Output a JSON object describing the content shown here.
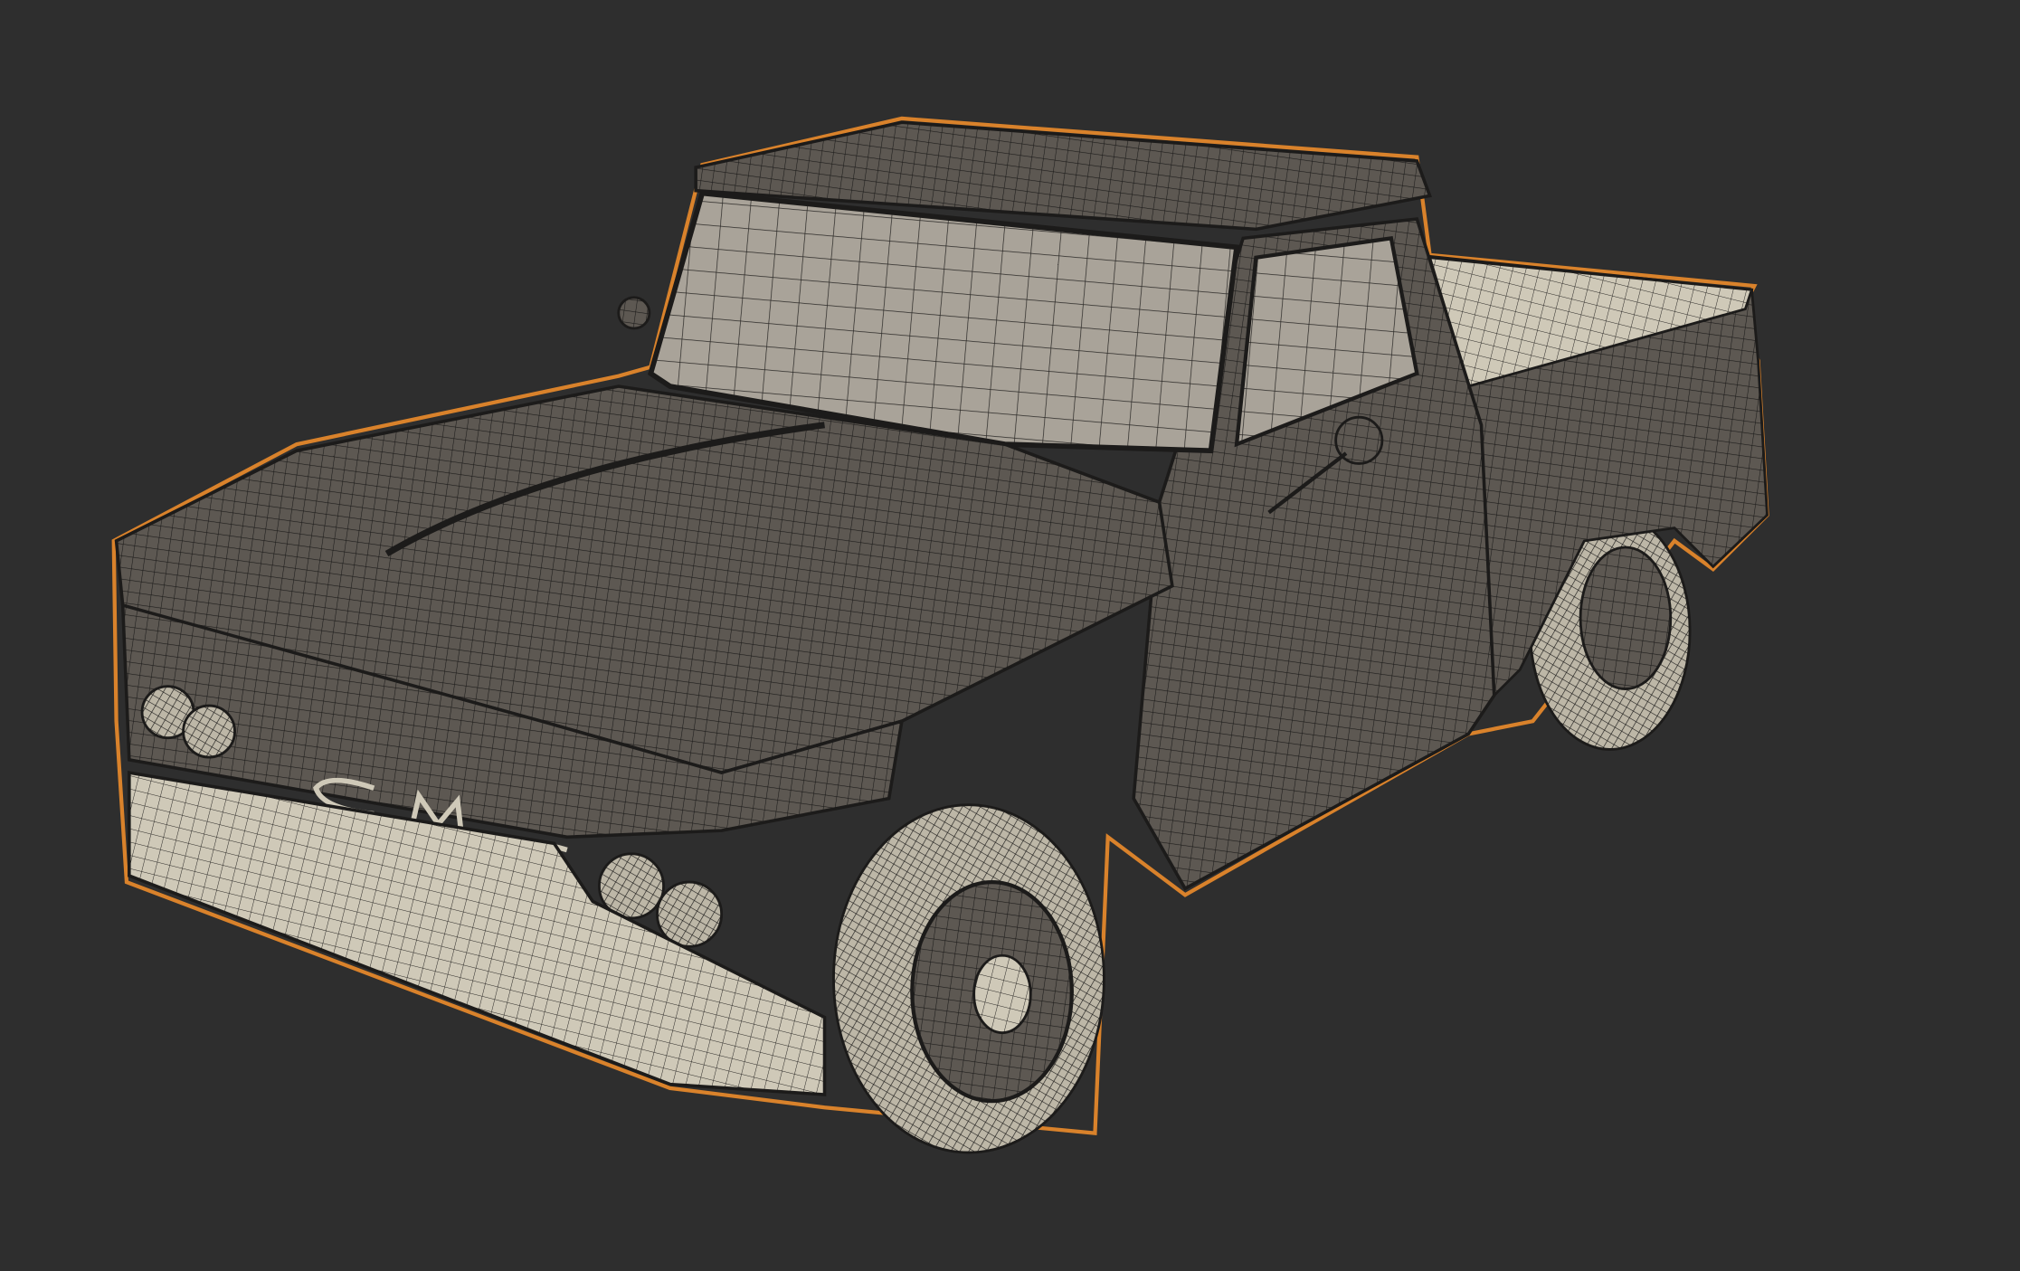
{
  "viewport": {
    "background": "#2e2e2e",
    "selection_outline_color": "#d9822b",
    "wire_color": "#1c1b1a",
    "body_color": "#5d5852",
    "light_surface_color": "#cfc9b8"
  },
  "model": {
    "name": "pickup-truck",
    "logo_text": "GMC"
  }
}
